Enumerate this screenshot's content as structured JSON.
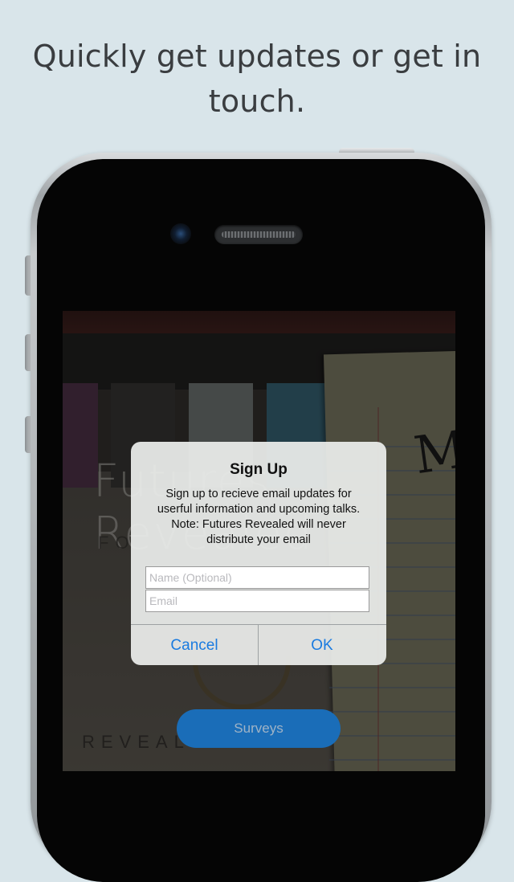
{
  "headline": {
    "line1": "Quickly get updates or get in",
    "line2": "touch."
  },
  "app_background": {
    "logo_text": "Futures Revealed",
    "logo_sub": "FO",
    "bottom_sub": "REVEAL"
  },
  "surveys_button": {
    "label": "Surveys"
  },
  "alert": {
    "title": "Sign Up",
    "message_line1": "Sign up to recieve email updates for",
    "message_line2": "userful information and upcoming talks.",
    "message_line3": "Note: Futures Revealed will never",
    "message_line4": "distribute your email",
    "name_field": {
      "placeholder": "Name (Optional)",
      "value": ""
    },
    "email_field": {
      "placeholder": "Email",
      "value": ""
    },
    "cancel_label": "Cancel",
    "ok_label": "OK"
  },
  "colors": {
    "page_background": "#d9e5ea",
    "accent_blue": "#1a7be0",
    "surveys_button": "#1a6db8"
  },
  "icons": {
    "camera": "front-camera-icon",
    "speaker": "earpiece-speaker-icon"
  }
}
